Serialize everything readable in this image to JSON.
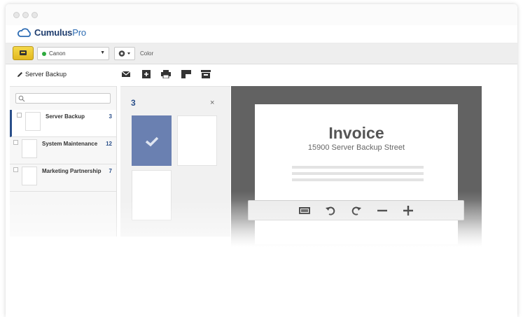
{
  "brand": {
    "name": "Cumulus",
    "suffix": "Pro"
  },
  "toolbar": {
    "printer": {
      "selected": "Canon",
      "status_color": "#2eaa3e"
    },
    "color_label": "Color"
  },
  "document": {
    "title": "Server Backup",
    "actions": [
      "mail-icon",
      "add-icon",
      "print-icon",
      "layout-icon",
      "archive-icon"
    ]
  },
  "sidebar": {
    "search": {
      "placeholder": ""
    },
    "items": [
      {
        "label": "Server Backup",
        "count": "3",
        "active": true
      },
      {
        "label": "System Maintenance",
        "count": "12",
        "active": false
      },
      {
        "label": "Marketing Partnership",
        "count": "7",
        "active": false
      }
    ]
  },
  "pages_panel": {
    "count": "3",
    "close_symbol": "×"
  },
  "preview": {
    "title": "Invoice",
    "subtitle": "15900 Server Backup Street",
    "controls": [
      "fit-icon",
      "rotate-left-icon",
      "rotate-right-icon",
      "zoom-out-icon",
      "zoom-in-icon"
    ]
  },
  "colors": {
    "accent": "#2a4f8a",
    "selected_page": "#6a80b1",
    "print_button": "#e9c42a"
  }
}
